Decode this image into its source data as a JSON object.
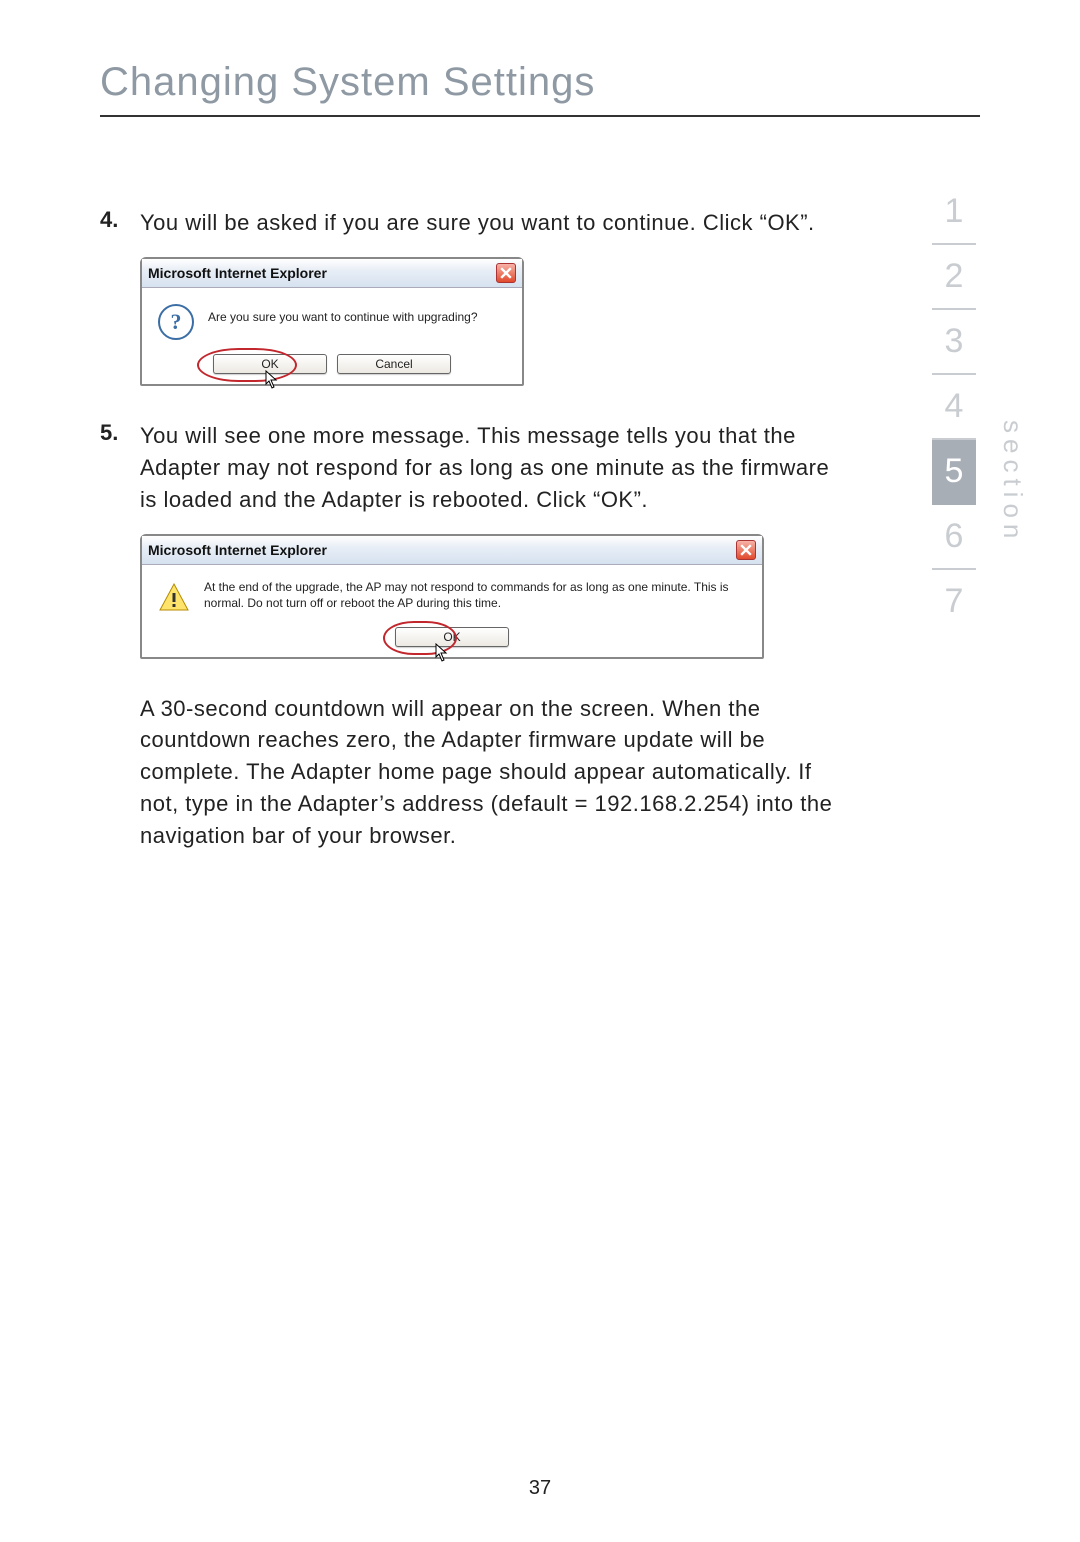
{
  "title": "Changing System Settings",
  "section_label": "section",
  "page_number": "37",
  "sidebar": {
    "items": [
      "1",
      "2",
      "3",
      "4",
      "5",
      "6",
      "7"
    ],
    "active_index": 4
  },
  "steps": [
    {
      "number": "4.",
      "text": "You will be asked if you are sure you want to continue. Click “OK”."
    },
    {
      "number": "5.",
      "text": "You will see one more message. This message tells you that the Adapter may not respond for as long as one minute as the firmware is loaded and the Adapter is rebooted. Click “OK”."
    }
  ],
  "dialog1": {
    "title": "Microsoft Internet Explorer",
    "message": "Are you sure you want to continue with upgrading?",
    "ok": "OK",
    "cancel": "Cancel"
  },
  "dialog2": {
    "title": "Microsoft Internet Explorer",
    "message": "At the end of the upgrade, the AP may not respond to commands for as long as one minute. This is normal. Do not turn off or reboot the AP during this time.",
    "ok": "OK"
  },
  "closing_paragraph": "A 30-second countdown will appear on the screen. When the countdown reaches zero, the Adapter firmware update will be complete. The Adapter home page should appear automatically. If not, type in the Adapter’s address (default = 192.168.2.254) into the navigation bar of your browser."
}
